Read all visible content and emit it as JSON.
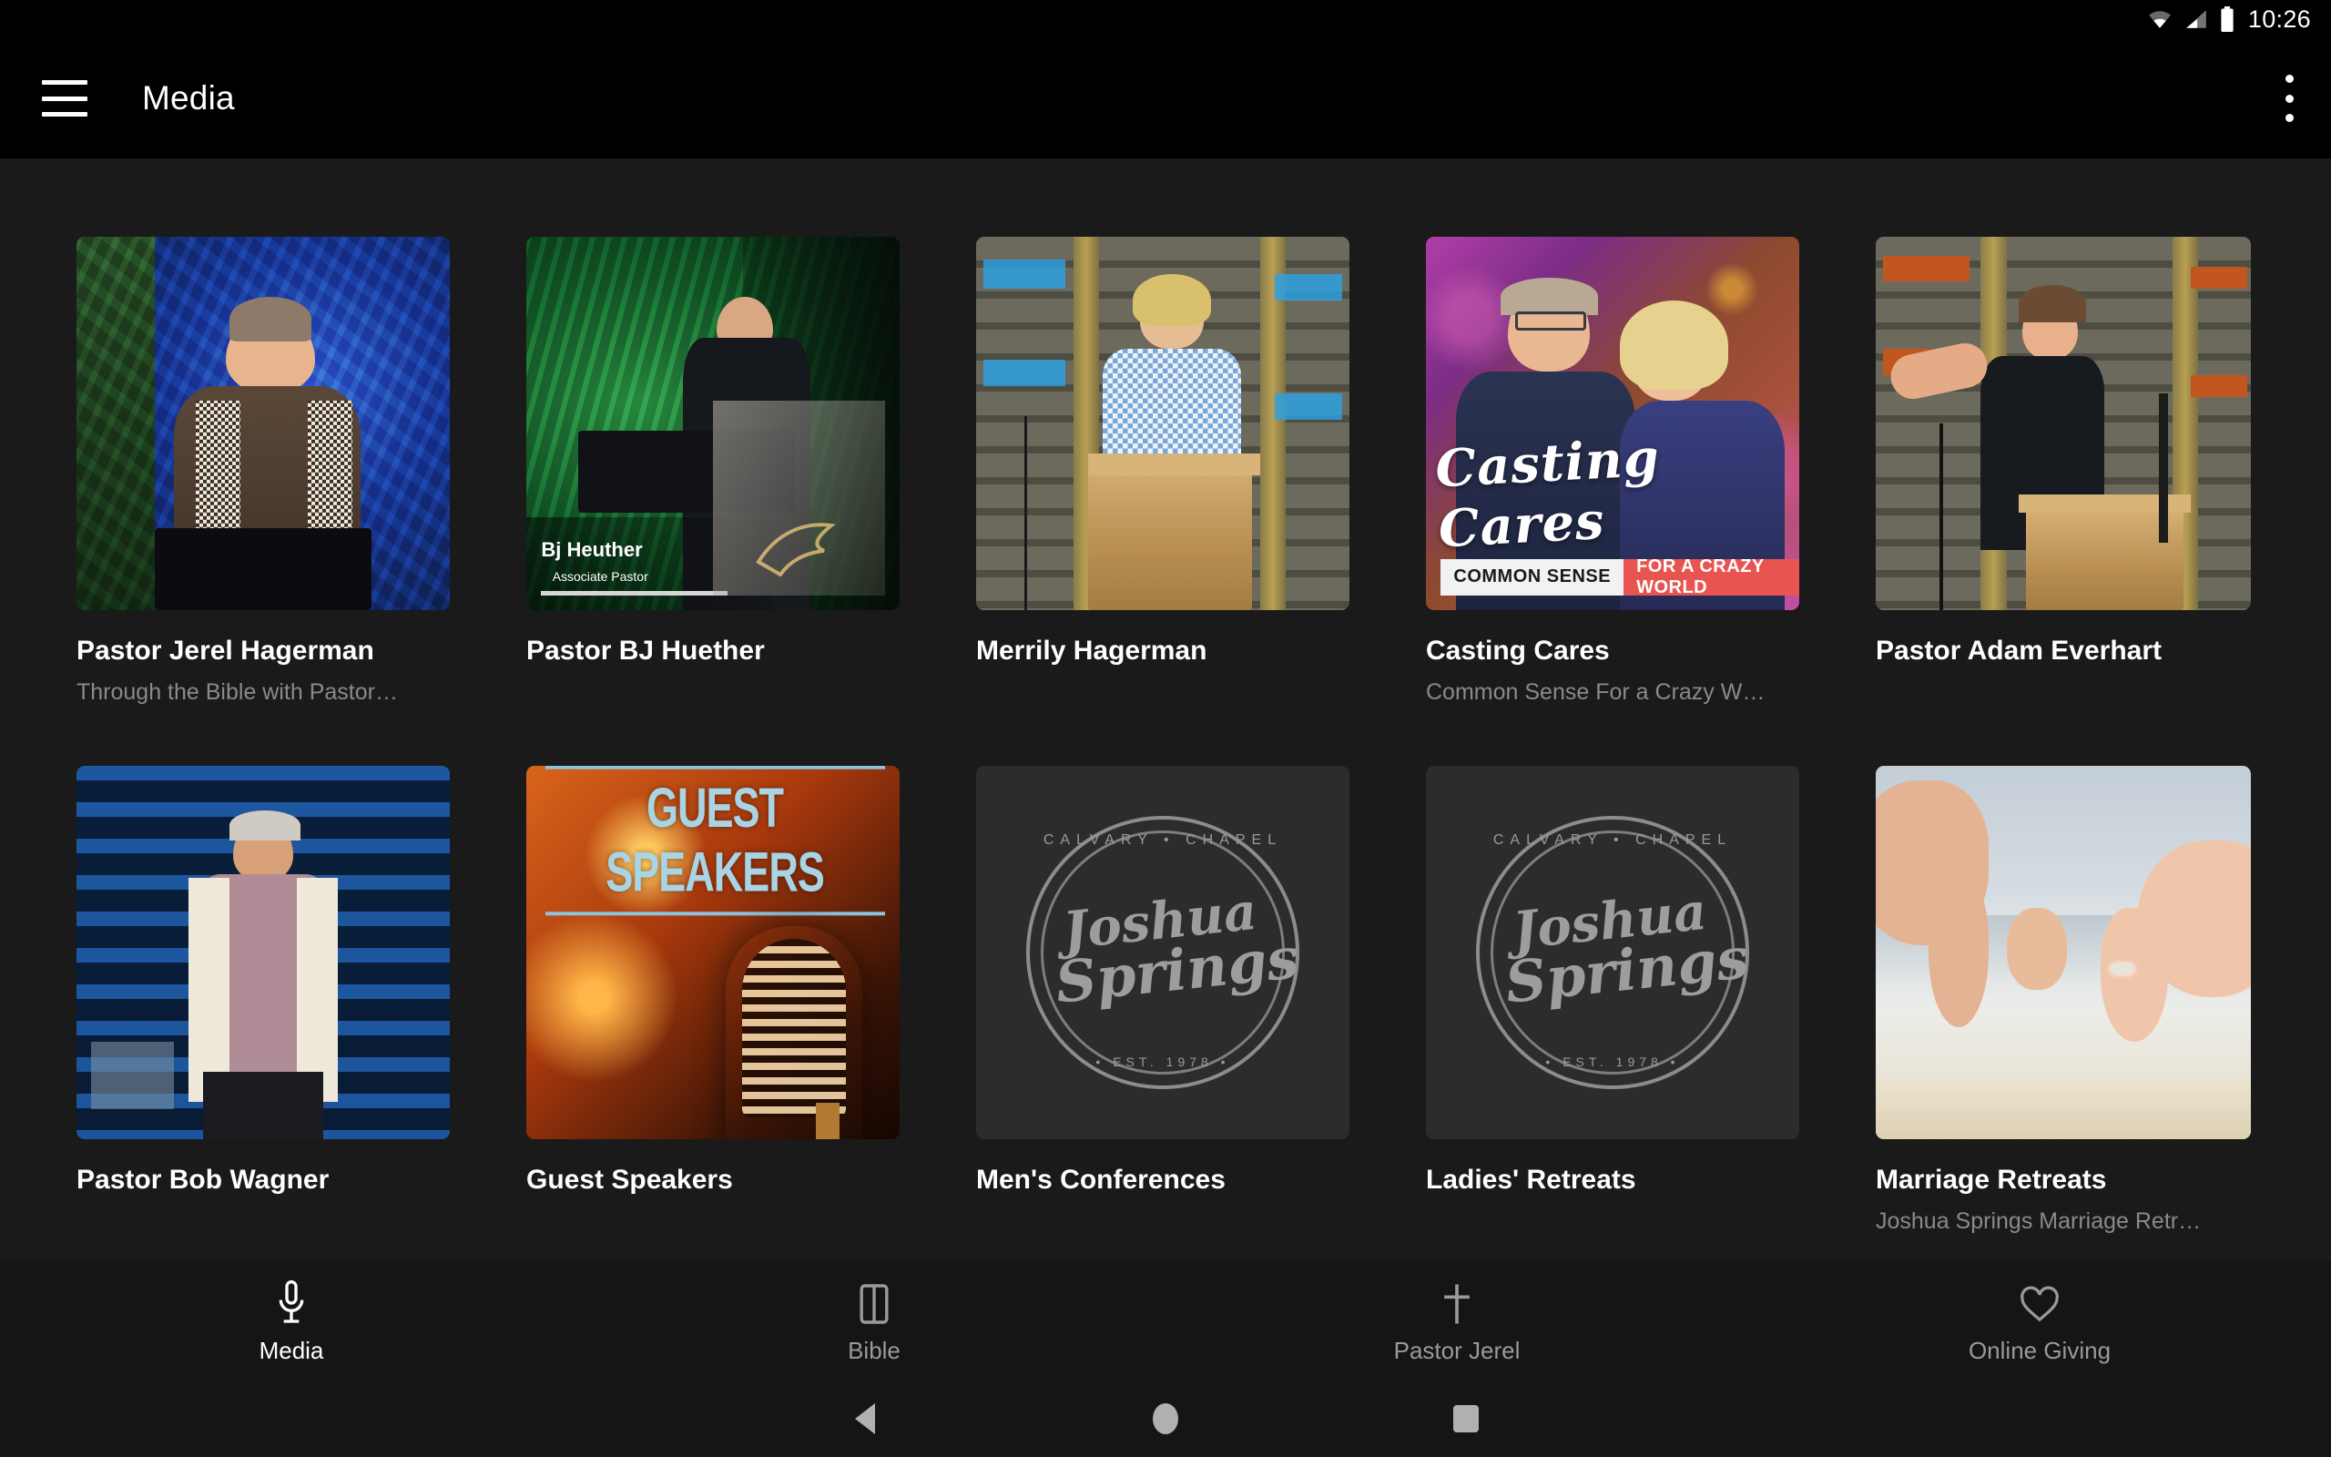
{
  "status_bar": {
    "time": "10:26",
    "icons": [
      "wifi-icon",
      "cellular-signal-icon",
      "battery-icon"
    ]
  },
  "app_bar": {
    "menu_icon": "hamburger-menu-icon",
    "title": "Media",
    "overflow_icon": "more-vertical-icon"
  },
  "media_grid": {
    "rows": [
      [
        {
          "title": "Pastor Jerel Hagerman",
          "subtitle": "Through the Bible with Pastor…",
          "art": "jerel"
        },
        {
          "title": "Pastor BJ Huether",
          "subtitle": "",
          "art": "bj",
          "overlay_name": "Bj Heuther",
          "overlay_role": "Associate Pastor"
        },
        {
          "title": "Merrily Hagerman",
          "subtitle": "",
          "art": "merrily"
        },
        {
          "title": "Casting Cares",
          "subtitle": "Common Sense For a Crazy W…",
          "art": "casting",
          "art_script": "Casting Cares",
          "art_left": "COMMON SENSE",
          "art_right": "FOR A CRAZY WORLD"
        },
        {
          "title": "Pastor Adam Everhart",
          "subtitle": "",
          "art": "adam"
        }
      ],
      [
        {
          "title": "Pastor Bob Wagner",
          "subtitle": "",
          "art": "bob"
        },
        {
          "title": "Guest Speakers",
          "subtitle": "",
          "art": "guest",
          "art_title": "GUEST SPEAKERS"
        },
        {
          "title": "Men's Conferences",
          "subtitle": "",
          "art": "logo",
          "logo_top": "CALVARY • CHAPEL",
          "logo_l1": "Joshua",
          "logo_l2": "Springs",
          "logo_bottom": "• EST. 1978 •"
        },
        {
          "title": "Ladies' Retreats",
          "subtitle": "",
          "art": "logo",
          "logo_top": "CALVARY • CHAPEL",
          "logo_l1": "Joshua",
          "logo_l2": "Springs",
          "logo_bottom": "• EST. 1978 •"
        },
        {
          "title": "Marriage Retreats",
          "subtitle": "Joshua Springs Marriage Retr…",
          "art": "marriage"
        }
      ]
    ]
  },
  "tab_bar": {
    "tabs": [
      {
        "label": "Media",
        "icon": "microphone-icon",
        "active": true
      },
      {
        "label": "Bible",
        "icon": "book-icon",
        "active": false
      },
      {
        "label": "Pastor Jerel",
        "icon": "cross-icon",
        "active": false
      },
      {
        "label": "Online Giving",
        "icon": "heart-icon",
        "active": false
      }
    ]
  },
  "system_nav": {
    "back": "back-triangle-icon",
    "home": "home-circle-icon",
    "recents": "recents-square-icon"
  },
  "colors": {
    "app_bar_bg": "#000000",
    "page_bg": "#1a1a1a",
    "tab_bar_bg": "#151515",
    "title_text": "#ffffff",
    "subtitle_text": "#8a8a8a",
    "inactive_tab": "#9a9a9a",
    "accent_red": "#e8544f"
  }
}
